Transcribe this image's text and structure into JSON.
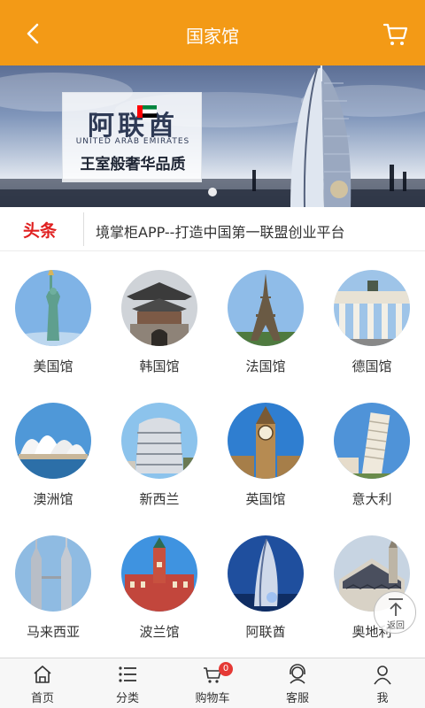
{
  "header": {
    "title": "国家馆",
    "back_icon": "chevron-left-icon",
    "cart_icon": "cart-icon"
  },
  "banner": {
    "title_cn": "阿联酋",
    "title_en": "UNITED ARAB EMIRATES",
    "slogan": "王室般奢华品质",
    "slide_count": 1,
    "active_slide": 1
  },
  "headline": {
    "tag": "头条",
    "text": "境掌柜APP--打造中国第一联盟创业平台"
  },
  "pavilions": [
    {
      "label": "美国馆"
    },
    {
      "label": "韩国馆"
    },
    {
      "label": "法国馆"
    },
    {
      "label": "德国馆"
    },
    {
      "label": "澳洲馆"
    },
    {
      "label": "新西兰"
    },
    {
      "label": "英国馆"
    },
    {
      "label": "意大利"
    },
    {
      "label": "马来西亚"
    },
    {
      "label": "波兰馆"
    },
    {
      "label": "阿联酋"
    },
    {
      "label": "奥地利"
    }
  ],
  "back_to_top": {
    "label": "返回",
    "icon": "arrow-up-icon"
  },
  "tabbar": {
    "items": [
      {
        "label": "首页",
        "icon": "home-icon"
      },
      {
        "label": "分类",
        "icon": "list-icon"
      },
      {
        "label": "购物车",
        "icon": "cart-icon"
      },
      {
        "label": "客服",
        "icon": "headset-icon"
      },
      {
        "label": "我",
        "icon": "user-icon"
      }
    ],
    "cart_badge": "0"
  },
  "colors": {
    "header_bg": "#f39a16",
    "headline_tag": "#e02020",
    "badge": "#e53935"
  }
}
